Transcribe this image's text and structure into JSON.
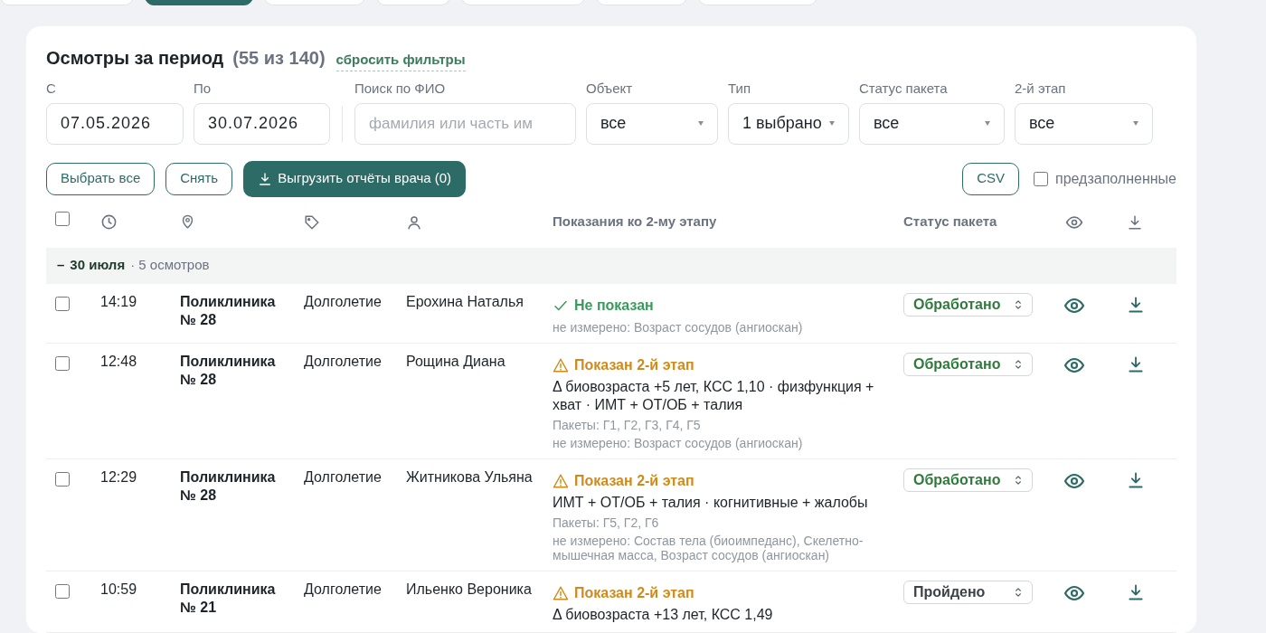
{
  "top_tabs": [
    {
      "selected": false
    },
    {
      "selected": true
    },
    {
      "selected": false
    },
    {
      "selected": false
    },
    {
      "selected": false
    },
    {
      "selected": false
    },
    {
      "selected": false
    }
  ],
  "title": "Осмотры за период",
  "count": "(55 из 140)",
  "reset_link": "сбросить фильтры",
  "filters": [
    {
      "kind": "date",
      "label": "С",
      "value": "07.05.2026"
    },
    {
      "kind": "date",
      "label": "По",
      "value": "30.07.2026"
    },
    {
      "kind": "search",
      "label": "Поиск по ФИО",
      "placeholder": "фамилия или часть им"
    },
    {
      "kind": "select",
      "label": "Объект",
      "value": "все"
    },
    {
      "kind": "select",
      "label": "Тип",
      "value": "1 выбрано"
    },
    {
      "kind": "select",
      "label": "Статус пакета",
      "value": "все"
    },
    {
      "kind": "select",
      "label": "2-й этап",
      "value": "все"
    }
  ],
  "actions": {
    "select_all": "Выбрать все",
    "clear": "Снять",
    "export": "Выгрузить отчёты врача (0)",
    "csv": "CSV",
    "prefilled": {
      "label": "предзаполненные",
      "checked": false
    }
  },
  "table": {
    "select_all_checked": false,
    "columns": {
      "indications": "Показания ко 2-му этапу",
      "status": "Статус пакета"
    },
    "group": {
      "toggle": "–",
      "date": "30 июля",
      "count": "· 5 осмотров"
    },
    "rows": [
      {
        "checked": false,
        "time": "14:19",
        "place": "Поликлиника № 28",
        "type": "Долголетие",
        "name": "Ерохина Наталья",
        "indication": {
          "kind": "not_shown",
          "title": "Не показан",
          "lines": [
            {
              "kind": "muted",
              "text": "не измерено: Возраст сосудов (ангиоскан)"
            }
          ]
        },
        "status": {
          "kind": "processed",
          "text": "Обработано"
        }
      },
      {
        "checked": false,
        "time": "12:48",
        "place": "Поликлиника № 28",
        "type": "Долголетие",
        "name": "Рощина Диана",
        "indication": {
          "kind": "shown",
          "title": "Показан 2-й этап",
          "lines": [
            {
              "kind": "main",
              "text": "Δ биовозраста +5 лет, КСС 1,10 · физфункция + хват · ИМТ + ОТ/ОБ + талия"
            },
            {
              "kind": "muted",
              "text": "Пакеты: Г1, Г2, Г3, Г4, Г5"
            },
            {
              "kind": "muted",
              "text": "не измерено: Возраст сосудов (ангиоскан)"
            }
          ]
        },
        "status": {
          "kind": "processed",
          "text": "Обработано"
        }
      },
      {
        "checked": false,
        "time": "12:29",
        "place": "Поликлиника № 28",
        "type": "Долголетие",
        "name": "Житникова Ульяна",
        "indication": {
          "kind": "shown",
          "title": "Показан 2-й этап",
          "lines": [
            {
              "kind": "main",
              "text": "ИМТ + ОТ/ОБ + талия · когнитивные + жалобы"
            },
            {
              "kind": "muted",
              "text": "Пакеты: Г5, Г2, Г6"
            },
            {
              "kind": "muted",
              "text": "не измерено: Состав тела (биоимпеданс), Скелетно-мышечная масса, Возраст сосудов (ангиоскан)"
            }
          ]
        },
        "status": {
          "kind": "processed",
          "text": "Обработано"
        }
      },
      {
        "checked": false,
        "time": "10:59",
        "place": "Поликлиника № 21",
        "type": "Долголетие",
        "name": "Ильенко Вероника",
        "indication": {
          "kind": "shown",
          "title": "Показан 2-й этап",
          "lines": [
            {
              "kind": "main",
              "text": "Δ биовозраста +13 лет, КСС 1,49"
            }
          ]
        },
        "status": {
          "kind": "passed",
          "text": "Пройдено"
        }
      }
    ]
  }
}
